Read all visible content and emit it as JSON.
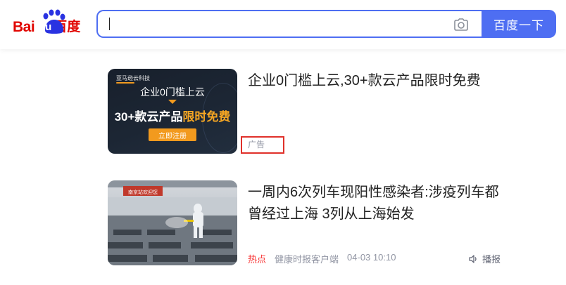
{
  "header": {
    "logo": {
      "bai": "Bai",
      "du": "du",
      "cn": "百度"
    },
    "search": {
      "value": ""
    },
    "search_button_label": "百度一下",
    "colors": {
      "brand_red": "#e10601",
      "brand_blue": "#2932e1",
      "accent": "#4e6ef2"
    }
  },
  "feed": {
    "ad_card": {
      "title": "企业0门槛上云,30+款云产品限时免费",
      "tag": "广告",
      "banner": {
        "brand": "亚马逊云科技",
        "line1": "企业0门槛上云",
        "line2_a": "30+款云产品",
        "line2_b": "限时免费",
        "cta": "立即注册"
      }
    },
    "news_card": {
      "title": "一周内6次列车现阳性感染者:涉疫列车都曾经过上海 3列从上海始发",
      "hot_label": "热点",
      "source": "健康时报客户端",
      "time": "04-03 10:10",
      "play_label": "播报",
      "image_sign_text": "南京站欢迎您"
    }
  }
}
